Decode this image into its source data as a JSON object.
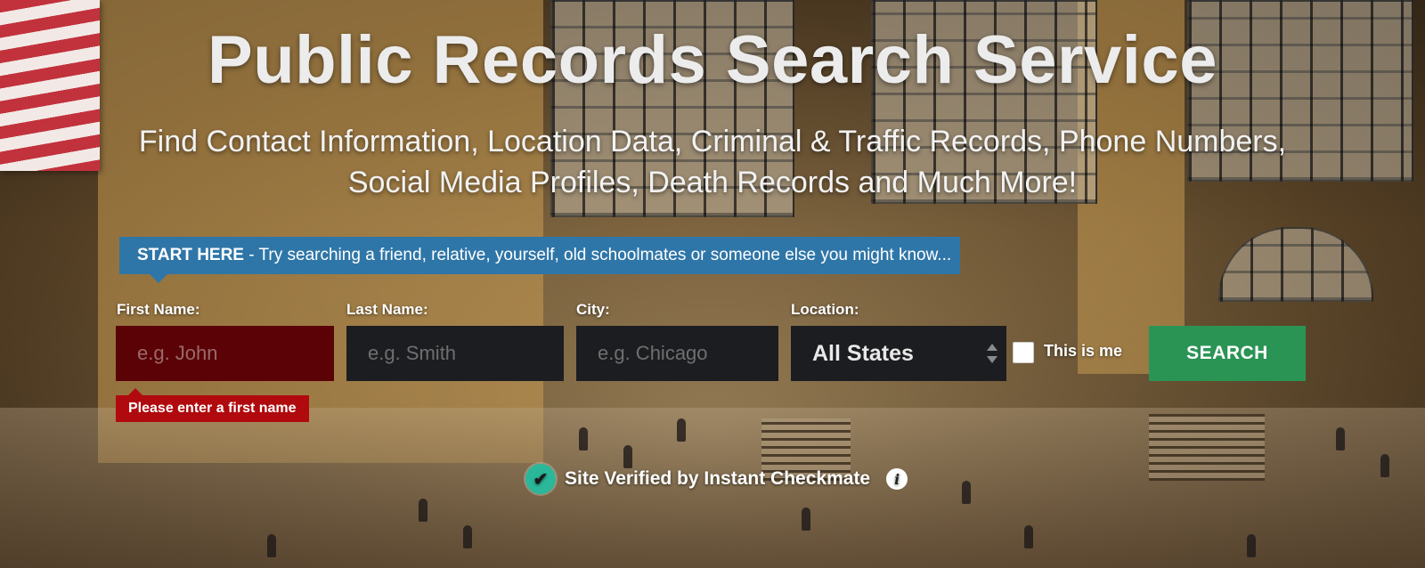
{
  "hero": {
    "title": "Public Records Search Service",
    "subtitle_line1": "Find Contact Information, Location Data, Criminal & Traffic Records, Phone Numbers,",
    "subtitle_line2": "Social Media Profiles, Death Records and Much More!"
  },
  "banner": {
    "bold": "START HERE",
    "text": " - Try searching a friend, relative, yourself, old schoolmates or someone else you might know..."
  },
  "form": {
    "first_name": {
      "label": "First Name:",
      "placeholder": "e.g. John",
      "value": ""
    },
    "last_name": {
      "label": "Last Name:",
      "placeholder": "e.g. Smith",
      "value": ""
    },
    "city": {
      "label": "City:",
      "placeholder": "e.g. Chicago",
      "value": ""
    },
    "location": {
      "label": "Location:",
      "selected": "All States"
    },
    "this_is_me": {
      "label": "This is me",
      "checked": false
    },
    "search_label": "SEARCH",
    "error": "Please enter a first name"
  },
  "verified": {
    "text": "Site Verified by Instant Checkmate",
    "check_icon": "checkmark-icon",
    "info_icon": "info-icon"
  },
  "colors": {
    "banner": "#2f76a8",
    "search_button": "#2a9455",
    "error": "#b00a0e",
    "error_field": "#5a0205",
    "input_bg": "#1c1d20",
    "check": "#2bb89a"
  }
}
